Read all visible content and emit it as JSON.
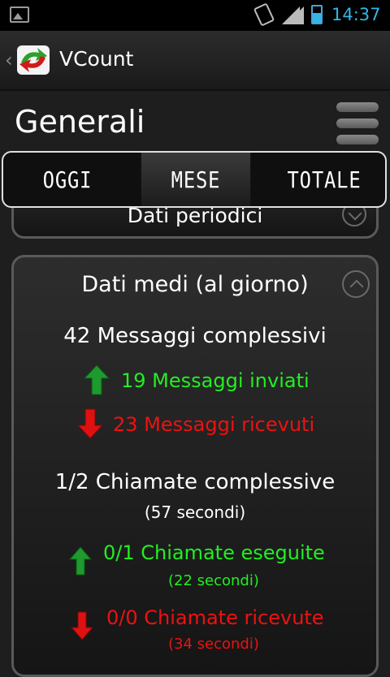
{
  "status_bar": {
    "time": "14:37",
    "icons": [
      "gallery-icon",
      "vibrate-icon",
      "wifi-signal-icon",
      "cell-signal-icon",
      "battery-icon"
    ],
    "accent_color": "#33b5e5"
  },
  "action_bar": {
    "title": "VCount",
    "logo": "vcount-logo-icon",
    "back": "chevron-left-icon"
  },
  "page": {
    "title": "Generali"
  },
  "tabs": [
    {
      "label": "OGGI",
      "active": false
    },
    {
      "label": "MESE",
      "active": true
    },
    {
      "label": "TOTALE",
      "active": false
    }
  ],
  "card_periodic": {
    "title": "Dati periodici",
    "toggle": "chevron-down-circle-icon"
  },
  "card_average": {
    "title": "Dati medi (al giorno)",
    "toggle": "chevron-up-circle-icon",
    "messages_total": "42 Messaggi complessivi",
    "messages_sent": "19 Messaggi inviati",
    "messages_received": "23 Messaggi ricevuti",
    "calls_total": "1/2 Chiamate complessive",
    "calls_total_duration": "(57 secondi)",
    "calls_made": "0/1 Chiamate eseguite",
    "calls_made_duration": "(22 secondi)",
    "calls_received": "0/0 Chiamate ricevute",
    "calls_received_duration": "(34 secondi)"
  },
  "colors": {
    "sent": "#22ee22",
    "received": "#ee1111"
  }
}
